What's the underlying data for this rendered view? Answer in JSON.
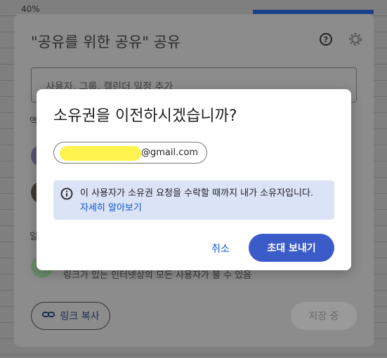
{
  "background": {
    "cell_value": "40%"
  },
  "share_dialog": {
    "title": "\"공유를 위한 공유\" 공유",
    "add_people_placeholder": "사용자, 그룹, 캘린더 일정 추가",
    "fragment_a": "액",
    "fragment_b": "일",
    "link_description": "링크가 있는 인터넷상의 모든 사용자가 볼 수 있음",
    "copy_link_label": "링크 복사",
    "save_label": "저장 중"
  },
  "modal": {
    "title": "소유권을 이전하시겠습니까?",
    "email_suffix": "@gmail.com",
    "info_text": "이 사용자가 소유권 요청을 수락할 때까지 내가 소유자입니다.",
    "info_link": "자세히 알아보기",
    "cancel_label": "취소",
    "send_label": "초대 보내기"
  },
  "colors": {
    "primary": "#3b5bc9",
    "link": "#0b57d0",
    "info_bg": "#dbe3f7",
    "redaction": "#fff44f"
  },
  "icons": {
    "help": "help-circle-icon",
    "settings": "gear-icon",
    "info": "info-icon",
    "link": "link-icon"
  }
}
